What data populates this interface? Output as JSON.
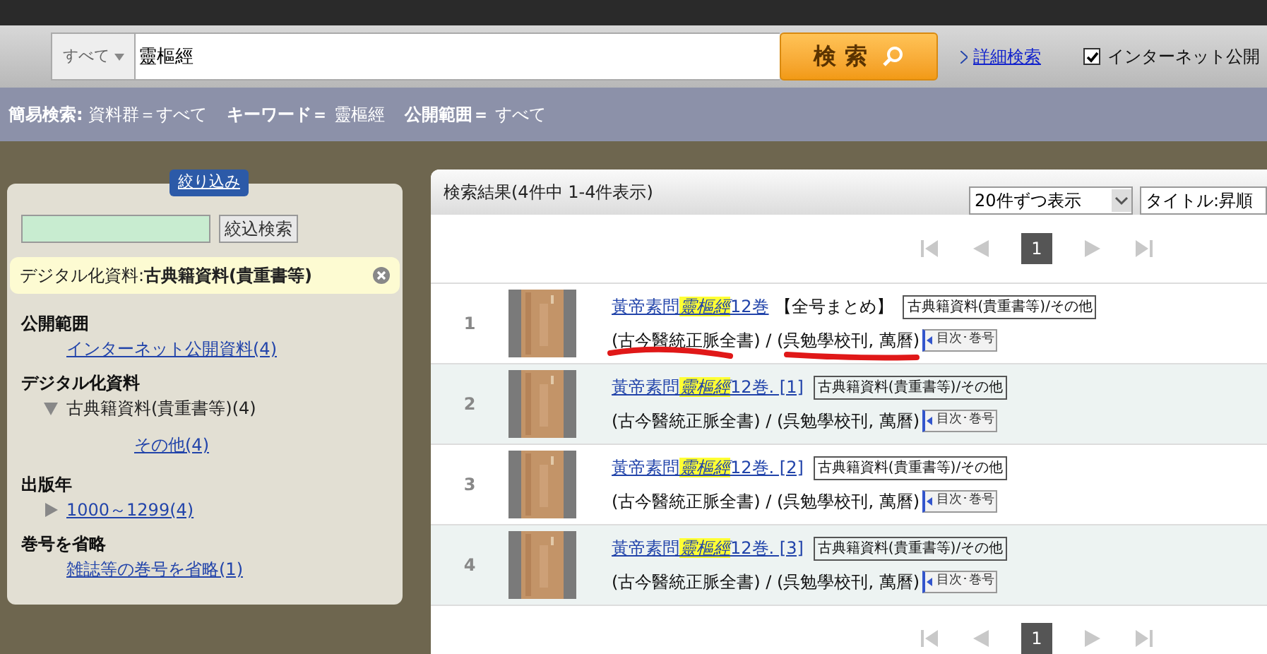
{
  "search": {
    "scope": "すべて",
    "value": "靈樞經",
    "button": "検 索",
    "advanced_link": "詳細検索",
    "internet_public": {
      "label": "インターネット公開",
      "checked": true
    }
  },
  "summary": [
    {
      "key": "簡易検索:",
      "value": "資料群＝すべて"
    },
    {
      "key": "キーワード＝",
      "value": "靈樞經"
    },
    {
      "key": "公開範囲＝",
      "value": "すべて"
    }
  ],
  "filter": {
    "tab": "絞り込み",
    "button": "絞込検索",
    "active": {
      "label": "デジタル化資料:",
      "value": "古典籍資料(貴重書等)"
    },
    "groups": [
      {
        "title": "公開範囲",
        "items": [
          {
            "label": "インターネット公開資料(4)",
            "kind": "link"
          }
        ]
      },
      {
        "title": "デジタル化資料",
        "items": [
          {
            "label": "古典籍資料(貴重書等)(4)",
            "kind": "text",
            "expanded": true,
            "children": [
              {
                "label": "その他(4)",
                "kind": "link"
              }
            ]
          }
        ]
      },
      {
        "title": "出版年",
        "items": [
          {
            "label": "1000～1299(4)",
            "kind": "link",
            "expanded": false
          }
        ]
      },
      {
        "title": "巻号を省略",
        "items": [
          {
            "label": "雑誌等の巻号を省略(1)",
            "kind": "link"
          }
        ]
      }
    ]
  },
  "results": {
    "title": "検索結果(4件中 1-4件表示)",
    "per_page": "20件ずつ表示",
    "sort": "タイトル:昇順",
    "pages": [
      {
        "label": "1",
        "selected": true
      }
    ],
    "bottom_pages": [
      {
        "label": "1",
        "selected": true
      }
    ],
    "rows": [
      {
        "number": "1",
        "title_prefix": "黃帝素問",
        "title_highlight": "靈樞經",
        "title_suffix": "12巻",
        "extra": "【全号まとめ】",
        "category": "古典籍資料(貴重書等)/その他",
        "series": "(古今醫統正脈全書) / (呉勉學校刊, 萬曆)",
        "toc": "目次･巻号",
        "underlined": true
      },
      {
        "number": "2",
        "title_prefix": "黃帝素問",
        "title_highlight": "靈樞經",
        "title_suffix": "12巻. [1]",
        "category": "古典籍資料(貴重書等)/その他",
        "series": "(古今醫統正脈全書) / (呉勉學校刊, 萬曆)",
        "toc": "目次･巻号",
        "underlined": false
      },
      {
        "number": "3",
        "title_prefix": "黃帝素問",
        "title_highlight": "靈樞經",
        "title_suffix": "12巻. [2]",
        "category": "古典籍資料(貴重書等)/その他",
        "series": "(古今醫統正脈全書) / (呉勉學校刊, 萬曆)",
        "toc": "目次･巻号",
        "underlined": false
      },
      {
        "number": "4",
        "title_prefix": "黃帝素問",
        "title_highlight": "靈樞經",
        "title_suffix": "12巻. [3]",
        "category": "古典籍資料(貴重書等)/その他",
        "series": "(古今醫統正脈全書) / (呉勉學校刊, 萬曆)",
        "toc": "目次･巻号",
        "underlined": false
      }
    ]
  }
}
